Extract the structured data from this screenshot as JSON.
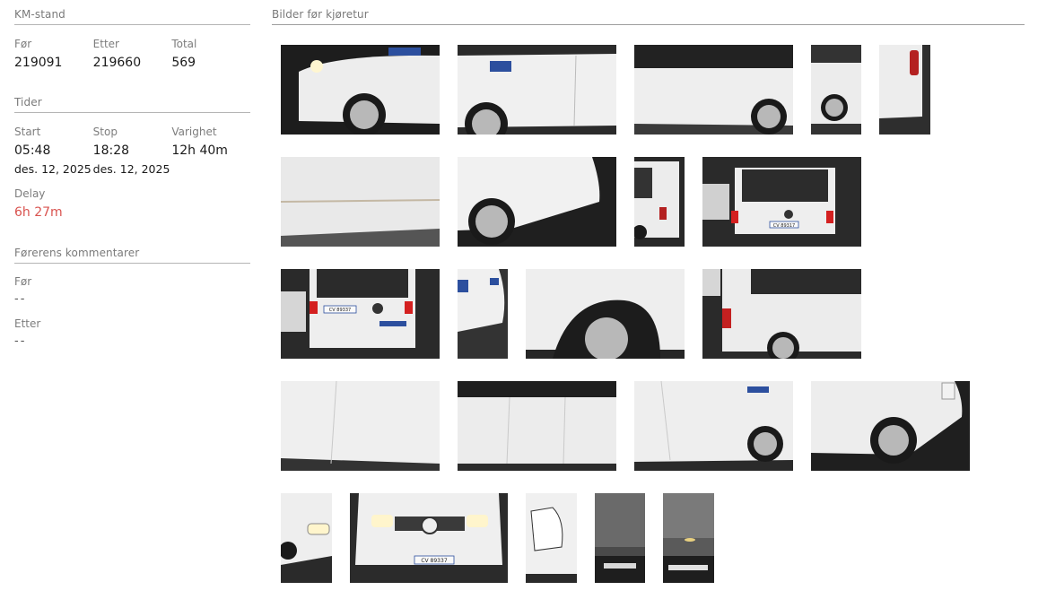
{
  "km": {
    "title": "KM-stand",
    "before_label": "Før",
    "before_value": "219091",
    "after_label": "Etter",
    "after_value": "219660",
    "total_label": "Total",
    "total_value": "569"
  },
  "times": {
    "title": "Tider",
    "start_label": "Start",
    "start_time": "05:48",
    "start_date": "des. 12, 2025",
    "stop_label": "Stop",
    "stop_time": "18:28",
    "stop_date": "des. 12, 2025",
    "duration_label": "Varighet",
    "duration_value": "12h 40m",
    "delay_label": "Delay",
    "delay_value": "6h 27m"
  },
  "comments": {
    "title": "Førerens kommentarer",
    "before_label": "Før",
    "before_value": "--",
    "after_label": "Etter",
    "after_value": "--"
  },
  "photos": {
    "title": "Bilder før kjøretur",
    "plates": [
      "CV 89317",
      "CV 89337",
      "CV 89337"
    ]
  },
  "colors": {
    "delay": "#d9534f",
    "divider": "#b5b5b5"
  }
}
